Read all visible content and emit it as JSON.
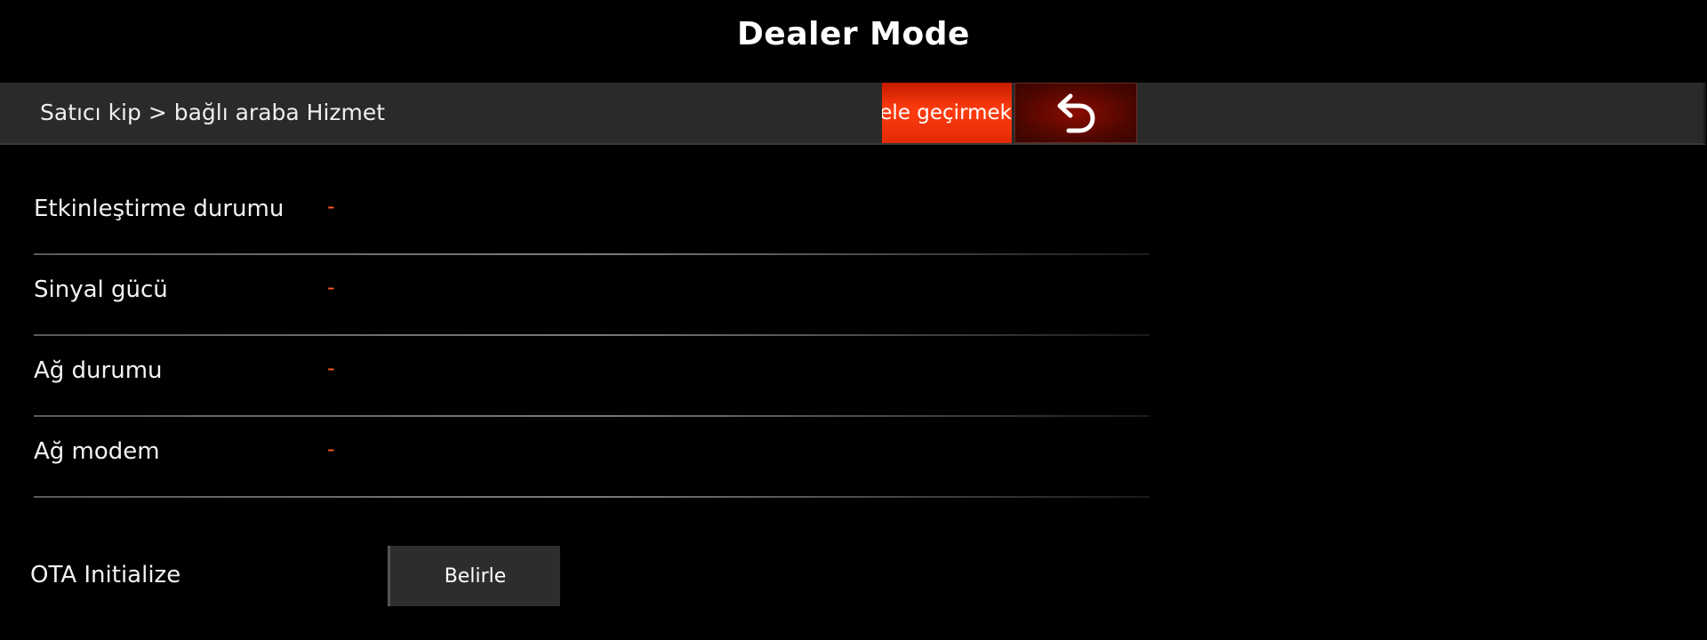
{
  "app": {
    "title": "Dealer Mode"
  },
  "header": {
    "breadcrumb": "Satıcı kip > bağlı araba Hizmet",
    "tab_label": "ele geçirmek",
    "back_icon": "return-arrow-icon"
  },
  "colors": {
    "accent": "#ff3c0f",
    "value_color": "#ff5a1e",
    "background": "#000000",
    "bar": "#2a2a2a"
  },
  "status_rows": [
    {
      "label": "Etkinleştirme durumu",
      "value": "-"
    },
    {
      "label": "Sinyal gücü",
      "value": "-"
    },
    {
      "label": "Ağ durumu",
      "value": "-"
    },
    {
      "label": "Ağ modem",
      "value": "-"
    }
  ],
  "ota": {
    "label": "OTA Initialize",
    "button_label": "Belirle"
  }
}
